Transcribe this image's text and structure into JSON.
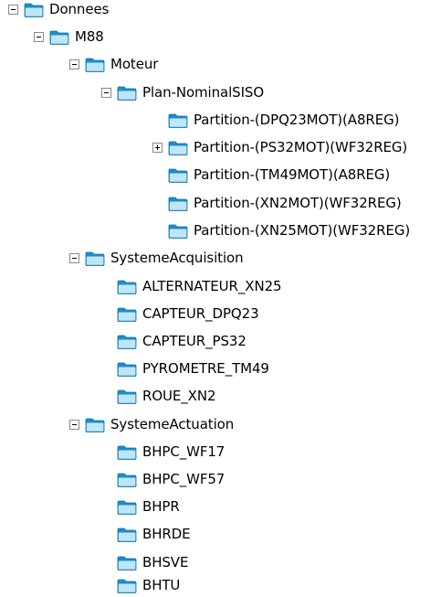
{
  "tree": [
    {
      "label": "Donnees",
      "level": 0,
      "toggle": "minus"
    },
    {
      "label": "M88",
      "level": 1,
      "toggle": "minus"
    },
    {
      "label": "Moteur",
      "level": 2,
      "toggle": "minus"
    },
    {
      "label": "Plan-NominalSISO",
      "level": 3,
      "toggle": "minus"
    },
    {
      "label": "Partition-(DPQ23MOT)(A8REG)",
      "level": 4,
      "toggle": "none"
    },
    {
      "label": "Partition-(PS32MOT)(WF32REG)",
      "level": 4,
      "toggle": "plus"
    },
    {
      "label": "Partition-(TM49MOT)(A8REG)",
      "level": 4,
      "toggle": "none"
    },
    {
      "label": "Partition-(XN2MOT)(WF32REG)",
      "level": 4,
      "toggle": "none"
    },
    {
      "label": "Partition-(XN25MOT)(WF32REG)",
      "level": 4,
      "toggle": "none"
    },
    {
      "label": "SystemeAcquisition",
      "level": 2,
      "toggle": "minus"
    },
    {
      "label": "ALTERNATEUR_XN25",
      "level": 3,
      "toggle": "none"
    },
    {
      "label": "CAPTEUR_DPQ23",
      "level": 3,
      "toggle": "none"
    },
    {
      "label": "CAPTEUR_PS32",
      "level": 3,
      "toggle": "none"
    },
    {
      "label": "PYROMETRE_TM49",
      "level": 3,
      "toggle": "none"
    },
    {
      "label": "ROUE_XN2",
      "level": 3,
      "toggle": "none"
    },
    {
      "label": "SystemeActuation",
      "level": 2,
      "toggle": "minus"
    },
    {
      "label": "BHPC_WF17",
      "level": 3,
      "toggle": "none"
    },
    {
      "label": "BHPC_WF57",
      "level": 3,
      "toggle": "none"
    },
    {
      "label": "BHPR",
      "level": 3,
      "toggle": "none"
    },
    {
      "label": "BHRDE",
      "level": 3,
      "toggle": "none"
    },
    {
      "label": "BHSVE",
      "level": 3,
      "toggle": "none"
    },
    {
      "label": "BHTU",
      "level": 3,
      "toggle": "none"
    }
  ],
  "colors": {
    "folder_back": "#1b8ec9",
    "folder_front": "#bfe6f8",
    "folder_stroke": "#1670a8"
  },
  "icons": {
    "folder": "folder-icon",
    "expanded": "minus-box-icon",
    "collapsed": "plus-box-icon"
  }
}
